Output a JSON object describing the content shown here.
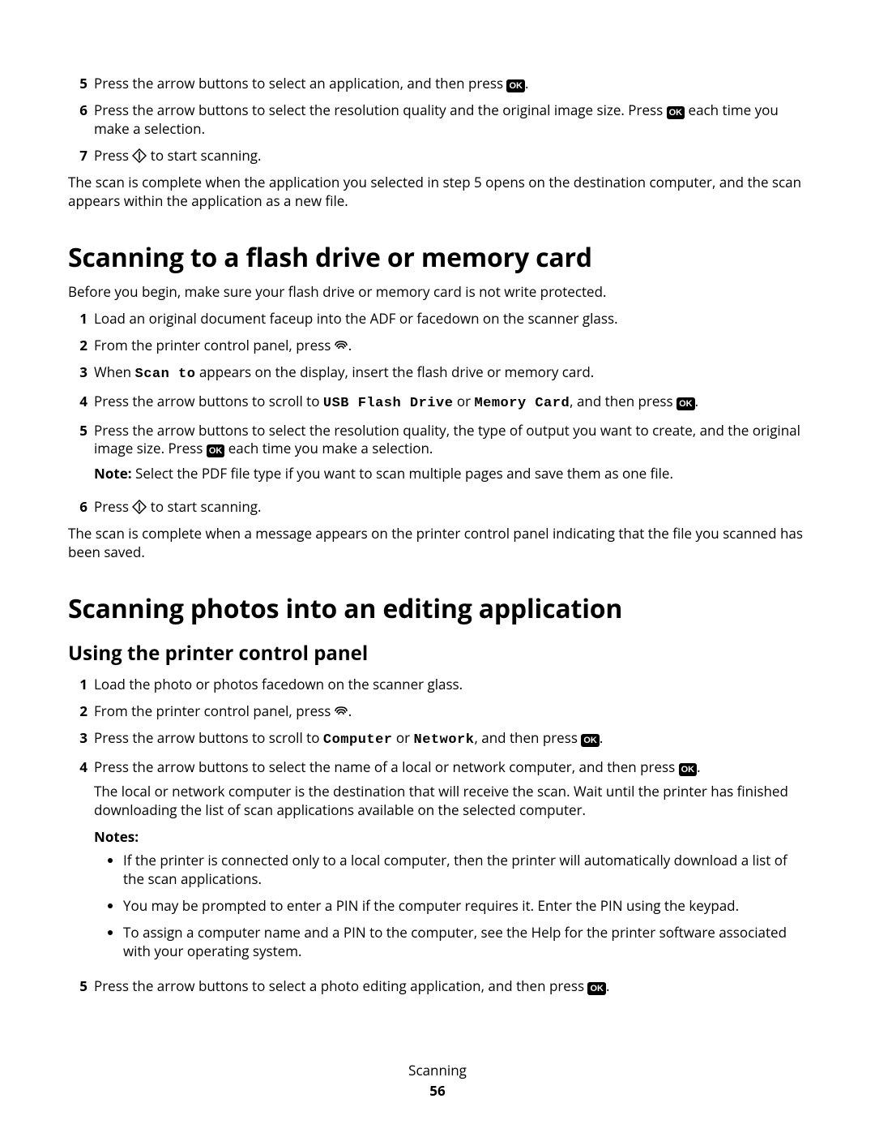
{
  "icons": {
    "ok": "OK"
  },
  "top_steps": [
    {
      "n": "5",
      "pre": "Press the arrow buttons to select an application, and then press ",
      "post": "."
    },
    {
      "n": "6",
      "pre": "Press the arrow buttons to select the resolution quality and the original image size. Press ",
      "post": " each time you make a selection."
    },
    {
      "n": "7",
      "pre": "Press ",
      "post": " to start scanning."
    }
  ],
  "top_para": "The scan is complete when the application you selected in step 5 opens on the destination computer, and the scan appears within the application as a new file.",
  "flash": {
    "heading": "Scanning to a flash drive or memory card",
    "intro": "Before you begin, make sure your flash drive or memory card is not write protected.",
    "steps": {
      "s1": {
        "n": "1",
        "text": "Load an original document faceup into the ADF or facedown on the scanner glass."
      },
      "s2": {
        "n": "2",
        "pre": "From the printer control panel, press ",
        "post": "."
      },
      "s3": {
        "n": "3",
        "pre": "When ",
        "mono1": "Scan to",
        "post": " appears on the display, insert the flash drive or memory card."
      },
      "s4": {
        "n": "4",
        "a": "Press the arrow buttons to scroll to ",
        "m1": "USB Flash Drive",
        "b": " or ",
        "m2": "Memory Card",
        "c": ", and then press ",
        "d": "."
      },
      "s5": {
        "n": "5",
        "a": "Press the arrow buttons to select the resolution quality, the type of output you want to create, and the original image size. Press ",
        "b": " each time you make a selection.",
        "note_label": "Note: ",
        "note_text": "Select the PDF file type if you want to scan multiple pages and save them as one file."
      },
      "s6": {
        "n": "6",
        "pre": "Press ",
        "post": " to start scanning."
      }
    },
    "outro": "The scan is complete when a message appears on the printer control panel indicating that the file you scanned has been saved."
  },
  "photos": {
    "heading": "Scanning photos into an editing application",
    "sub": "Using the printer control panel",
    "steps": {
      "s1": {
        "n": "1",
        "text": "Load the photo or photos facedown on the scanner glass."
      },
      "s2": {
        "n": "2",
        "pre": "From the printer control panel, press ",
        "post": "."
      },
      "s3": {
        "n": "3",
        "a": "Press the arrow buttons to scroll to ",
        "m1": "Computer",
        "b": " or ",
        "m2": "Network",
        "c": ", and then press ",
        "d": "."
      },
      "s4": {
        "n": "4",
        "a": "Press the arrow buttons to select the name of a local or network computer, and then press ",
        "b": ".",
        "para": "The local or network computer is the destination that will receive the scan. Wait until the printer has finished downloading the list of scan applications available on the selected computer.",
        "notes_label": "Notes:",
        "bullets": [
          "If the printer is connected only to a local computer, then the printer will automatically download a list of the scan applications.",
          "You may be prompted to enter a PIN if the computer requires it. Enter the PIN using the keypad.",
          "To assign a computer name and a PIN to the computer, see the Help for the printer software associated with your operating system."
        ]
      },
      "s5": {
        "n": "5",
        "a": "Press the arrow buttons to select a photo editing application, and then press ",
        "b": "."
      }
    }
  },
  "footer": {
    "label": "Scanning",
    "page": "56"
  }
}
